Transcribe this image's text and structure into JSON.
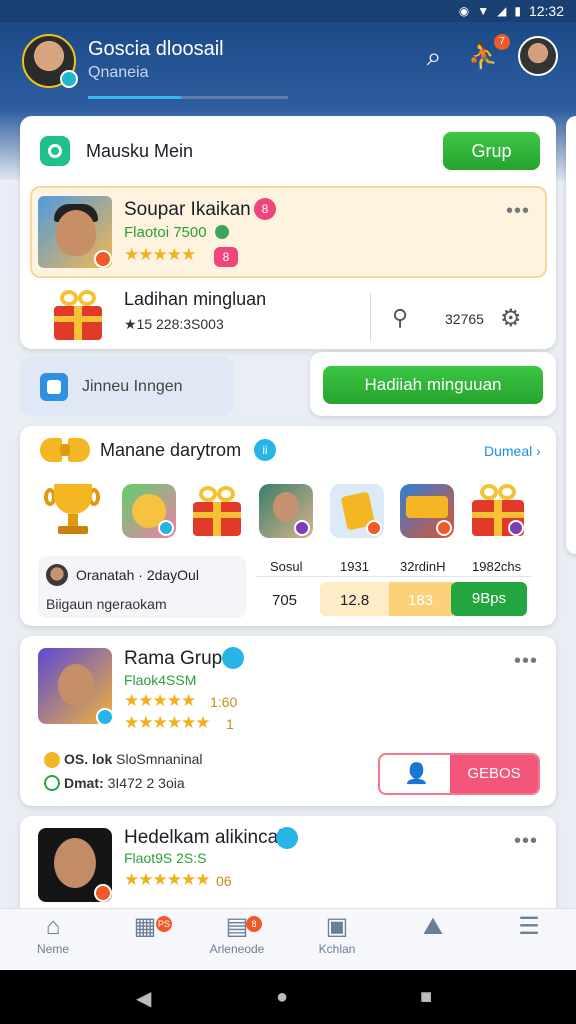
{
  "status_bar": {
    "time": "12:32"
  },
  "header": {
    "title": "Goscia dloosail",
    "subtitle": "Qnaneia",
    "search_icon": "search-icon",
    "notif_icon": "add-friend-icon",
    "notif_count": "7"
  },
  "card_main": {
    "title": "Mausku Mein",
    "grup_button": "Grup",
    "highlight": {
      "name": "Soupar Ikaikan",
      "badge": "8",
      "subtitle": "Flaotoi 7500",
      "stars": "★★★★★",
      "small_badge": "8"
    },
    "weekly": {
      "title": "Ladihan mingluan",
      "subtitle": "★15 228:3S003",
      "stat_value": "32765"
    }
  },
  "join_label": "Jinneu Inngen",
  "hadiah_button": "Hadiiah minguuan",
  "mission": {
    "title": "Manane darytrom",
    "badge": "ii",
    "detail_link": "Dumeal ›",
    "row_name": "Oranatah · 2dayOul",
    "row_sub": "Biigaun ngeraokam",
    "headers": [
      "Sosul",
      "1931",
      "32rdinH",
      "1982chs"
    ],
    "values": [
      "705",
      "12.8",
      "183",
      "9Bps"
    ]
  },
  "group_card": {
    "name": "Rama Grup",
    "subtitle": "Flaok4SSM",
    "stars": "★★★★★",
    "rating": "1:60",
    "stars2": "★★★★★★",
    "rating2": "1",
    "meta1_bold": "OS. lok",
    "meta1": "SloSmnaninal",
    "meta2_bold": "Dmat:",
    "meta2": "3I472 2 3oia",
    "action_button": "GEBOS"
  },
  "second_card": {
    "name": "Hedelkam alikincal",
    "subtitle": "Flaot9S 2S:S",
    "stars": "★★★★★★",
    "rating": "06"
  },
  "bottom_nav": [
    {
      "label": "Neme",
      "icon": "home-icon"
    },
    {
      "label": "",
      "icon": "gift-box-icon",
      "badge": "PS"
    },
    {
      "label": "Arleneode",
      "icon": "inbox-icon",
      "badge": "8"
    },
    {
      "label": "Kchlan",
      "icon": "message-icon"
    },
    {
      "label": "",
      "icon": "profile-icon"
    },
    {
      "label": "",
      "icon": "menu-icon"
    }
  ],
  "colors": {
    "brand": "#1c4a88",
    "green": "#26a32e",
    "pink": "#f4567a",
    "accent": "#35b8f0"
  }
}
